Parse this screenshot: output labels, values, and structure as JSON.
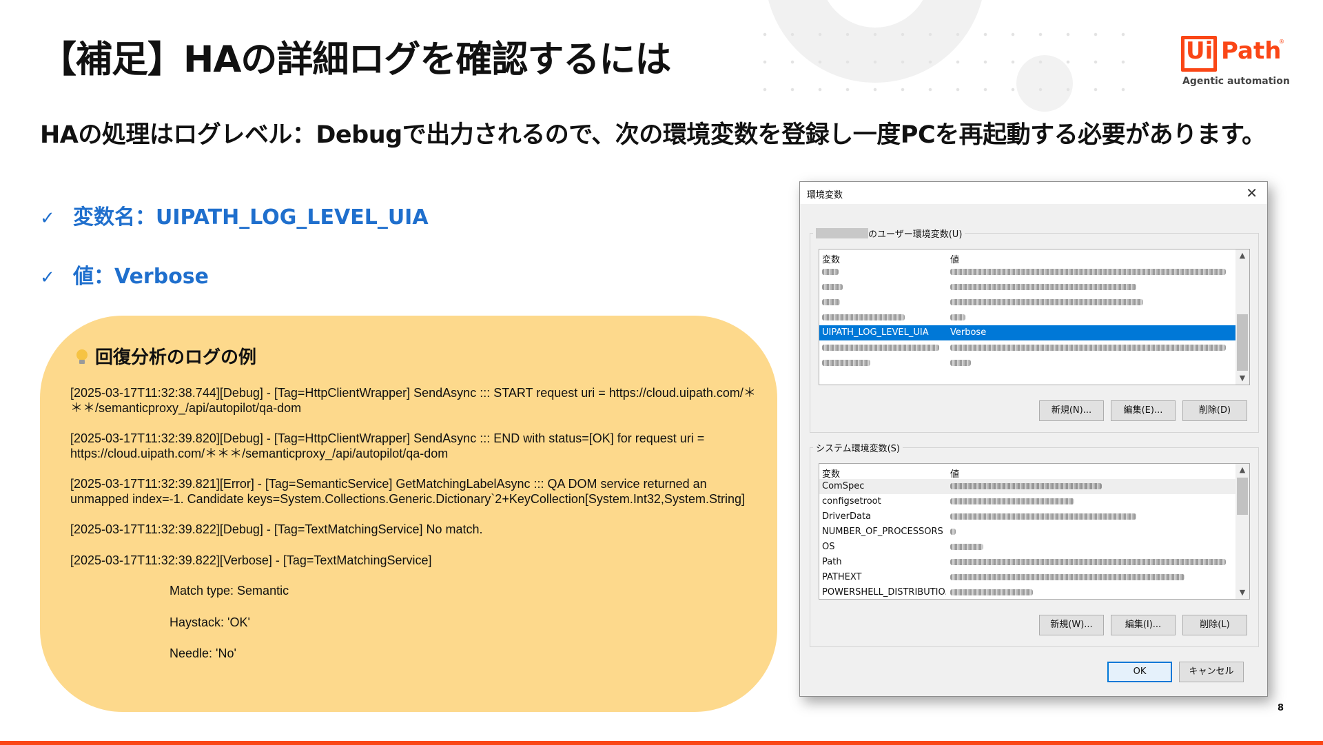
{
  "slide": {
    "title": "【補足】HAの詳細ログを確認するには",
    "subtitle": "HAの処理はログレベル：Debugで出力されるので、次の環境変数を登録し一度PCを再起動する必要があります。",
    "checklist": [
      {
        "mark": "✓",
        "text": "変数名：UIPATH_LOG_LEVEL_UIA"
      },
      {
        "mark": "✓",
        "text": "値：Verbose"
      }
    ],
    "page_number": "8",
    "accent_color": "#fa4616"
  },
  "logo": {
    "ui": "Ui",
    "path": "Path",
    "reg": "®",
    "tagline": "Agentic automation"
  },
  "log_panel": {
    "heading": "回復分析のログの例",
    "lines": [
      "[2025-03-17T11:32:38.744][Debug] - [Tag=HttpClientWrapper] SendAsync ::: START request uri = https://cloud.uipath.com/＊＊＊/semanticproxy_/api/autopilot/qa-dom",
      "[2025-03-17T11:32:39.820][Debug] - [Tag=HttpClientWrapper] SendAsync ::: END with status=[OK] for request uri = https://cloud.uipath.com/＊＊＊/semanticproxy_/api/autopilot/qa-dom",
      "[2025-03-17T11:32:39.821][Error] - [Tag=SemanticService] GetMatchingLabelAsync ::: QA DOM service returned an unmapped index=-1. Candidate keys=System.Collections.Generic.Dictionary`2+KeyCollection[System.Int32,System.String]",
      "[2025-03-17T11:32:39.822][Debug] - [Tag=TextMatchingService] No match.",
      "[2025-03-17T11:32:39.822][Verbose] - [Tag=TextMatchingService]"
    ],
    "details": [
      "Match type: Semantic",
      "Haystack: 'OK'",
      "Needle: 'No'"
    ]
  },
  "dialog": {
    "title": "環境変数",
    "close_glyph": "✕",
    "user_group_label": "のユーザー環境変数(U)",
    "system_group_label": "システム環境変数(S)",
    "col_variable": "変数",
    "col_value": "値",
    "selected_row": {
      "name": "UIPATH_LOG_LEVEL_UIA",
      "value": "Verbose"
    },
    "system_rows": [
      "ComSpec",
      "configsetroot",
      "DriverData",
      "NUMBER_OF_PROCESSORS",
      "OS",
      "Path",
      "PATHEXT",
      "POWERSHELL_DISTRIBUTIO..."
    ],
    "user_buttons": {
      "new": "新規(N)...",
      "edit": "編集(E)...",
      "delete": "削除(D)"
    },
    "system_buttons": {
      "new": "新規(W)...",
      "edit": "編集(I)...",
      "delete": "削除(L)"
    },
    "ok_label": "OK",
    "cancel_label": "キャンセル",
    "scroll_up": "▲",
    "scroll_down": "▼",
    "selection_color": "#0078d7"
  }
}
